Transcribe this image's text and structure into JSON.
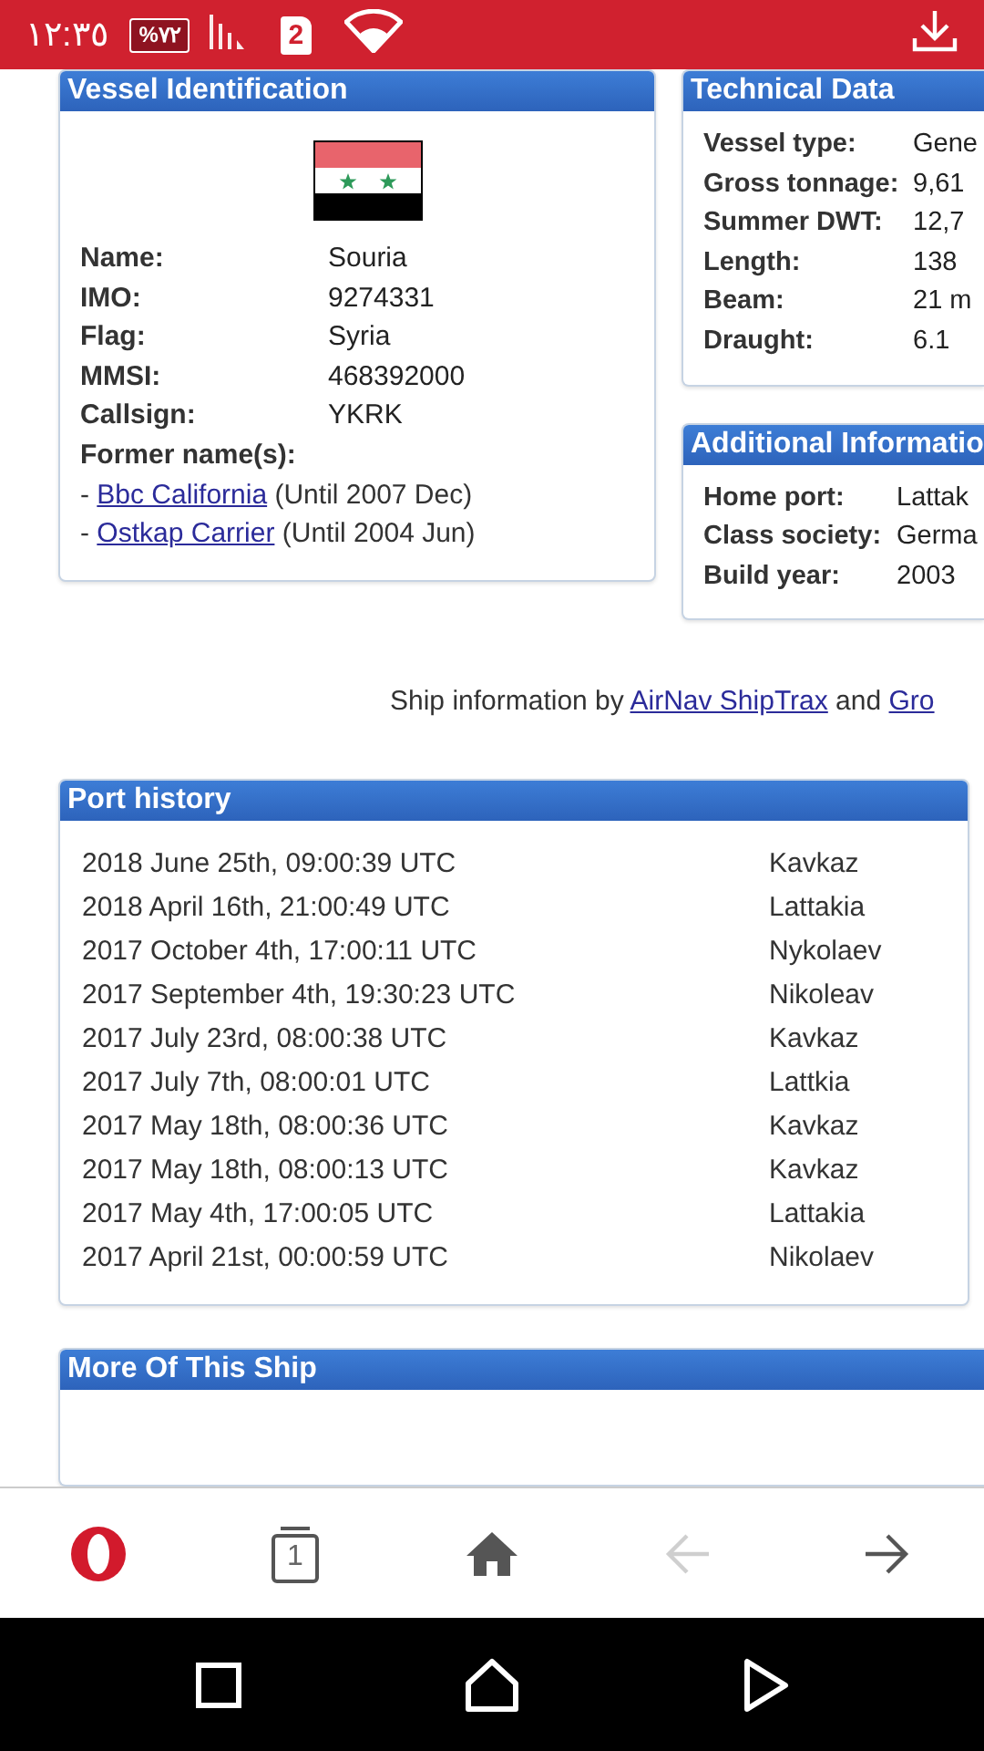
{
  "status_bar": {
    "time": "١٢:٣٥",
    "battery": "%٧٢",
    "sim": "2"
  },
  "vessel_identification": {
    "title": "Vessel Identification",
    "fields": [
      {
        "label": "Name:",
        "value": "Souria"
      },
      {
        "label": "IMO:",
        "value": "9274331"
      },
      {
        "label": "Flag:",
        "value": "Syria"
      },
      {
        "label": "MMSI:",
        "value": "468392000"
      },
      {
        "label": "Callsign:",
        "value": "YKRK"
      }
    ],
    "former_names_label": "Former name(s):",
    "former_names": [
      {
        "bullet": "-",
        "name": "Bbc California",
        "note": "(Until 2007 Dec)"
      },
      {
        "bullet": "-",
        "name": "Ostkap Carrier",
        "note": "(Until 2004 Jun)"
      }
    ]
  },
  "technical_data": {
    "title": "Technical Data",
    "fields": [
      {
        "label": "Vessel type:",
        "value": "Gene"
      },
      {
        "label": "Gross tonnage:",
        "value": "9,61"
      },
      {
        "label": "Summer DWT:",
        "value": "12,7"
      },
      {
        "label": "Length:",
        "value": "138"
      },
      {
        "label": "Beam:",
        "value": "21 m"
      },
      {
        "label": "Draught:",
        "value": "6.1"
      }
    ]
  },
  "additional_information": {
    "title": "Additional Informatio",
    "fields": [
      {
        "label": "Home port:",
        "value": "Lattak"
      },
      {
        "label": "Class society:",
        "value": "Germa"
      },
      {
        "label": "Build year:",
        "value": "2003"
      }
    ]
  },
  "credit": {
    "before": "Ship information by",
    "link_1": "AirNav ShipTrax",
    "between": "and",
    "link_2": "Gro"
  },
  "port_history": {
    "title": "Port history",
    "rows": [
      {
        "time": "2018 June 25th, 09:00:39 UTC",
        "port": "Kavkaz"
      },
      {
        "time": "2018 April 16th, 21:00:49 UTC",
        "port": "Lattakia"
      },
      {
        "time": "2017 October 4th, 17:00:11 UTC",
        "port": "Nykolaev"
      },
      {
        "time": "2017 September 4th, 19:30:23 UTC",
        "port": "Nikoleav"
      },
      {
        "time": "2017 July 23rd, 08:00:38 UTC",
        "port": "Kavkaz"
      },
      {
        "time": "2017 July 7th, 08:00:01 UTC",
        "port": "Lattkia"
      },
      {
        "time": "2017 May 18th, 08:00:36 UTC",
        "port": "Kavkaz"
      },
      {
        "time": "2017 May 18th, 08:00:13 UTC",
        "port": "Kavkaz"
      },
      {
        "time": "2017 May 4th, 17:00:05 UTC",
        "port": "Lattakia"
      },
      {
        "time": "2017 April 21st, 00:00:59 UTC",
        "port": "Nikolaev"
      }
    ]
  },
  "more_of_this_ship": {
    "title": "More Of This Ship"
  },
  "browser_toolbar": [
    {
      "kind": "logo"
    },
    {
      "kind": "tabs",
      "count": "1"
    },
    {
      "kind": "home"
    },
    {
      "kind": "back",
      "disabled": true
    },
    {
      "kind": "forward",
      "disabled": false
    }
  ],
  "navigation_bar": [
    {
      "kind": "recents"
    },
    {
      "kind": "home"
    },
    {
      "kind": "back"
    }
  ]
}
